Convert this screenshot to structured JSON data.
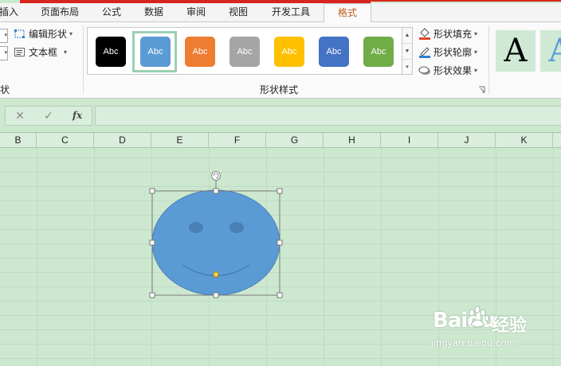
{
  "ribbon_tabs": [
    {
      "label": "插入"
    },
    {
      "label": "页面布局"
    },
    {
      "label": "公式"
    },
    {
      "label": "数据"
    },
    {
      "label": "审阅"
    },
    {
      "label": "视图"
    },
    {
      "label": "开发工具"
    },
    {
      "label": "格式",
      "active": true
    }
  ],
  "insert_shapes": {
    "edit_shape_label": "编辑形状",
    "textbox_label": "文本框",
    "group_label_partial": "状"
  },
  "shape_styles": {
    "group_label": "形状样式",
    "swatches": [
      {
        "label": "Abc",
        "fill": "#000000",
        "text_color": "#ffffff"
      },
      {
        "label": "Abc",
        "fill": "#5b9bd5",
        "text_color": "#ffffff",
        "selected": true
      },
      {
        "label": "Abc",
        "fill": "#ed7d31",
        "text_color": "#ffffff"
      },
      {
        "label": "Abc",
        "fill": "#a5a5a5",
        "text_color": "#ffffff"
      },
      {
        "label": "Abc",
        "fill": "#ffc000",
        "text_color": "#ffffff"
      },
      {
        "label": "Abc",
        "fill": "#4472c4",
        "text_color": "#ffffff"
      },
      {
        "label": "Abc",
        "fill": "#70ad47",
        "text_color": "#ffffff"
      }
    ],
    "fill_label": "形状填充",
    "outline_label": "形状轮廓",
    "effects_label": "形状效果"
  },
  "wordart": [
    {
      "label": "A",
      "color": "#000000"
    },
    {
      "label": "A",
      "color": "#5b9bd5"
    }
  ],
  "formula_bar": {
    "cancel_symbol": "✕",
    "enter_symbol": "✓",
    "fx_label": "fx",
    "value": ""
  },
  "columns": [
    "B",
    "C",
    "D",
    "E",
    "F",
    "G",
    "H",
    "I",
    "J",
    "K"
  ],
  "shape": {
    "type": "smiley-face",
    "fill": "#5b9bd5",
    "outline": "#4a7fb5"
  },
  "watermark": {
    "brand": "Baidu",
    "brand_cn": "经验",
    "url": "jingyan.baidu.com"
  },
  "colors": {
    "sheet_bg": "#cce8cf",
    "active_tab_text": "#c15c1b",
    "accent_red": "#d9241c"
  }
}
